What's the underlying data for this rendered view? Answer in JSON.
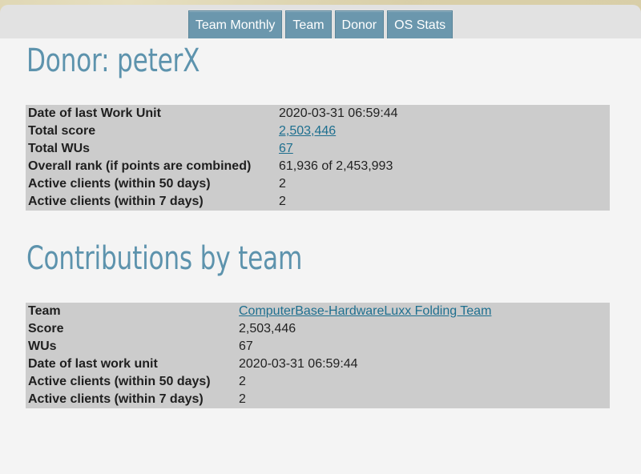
{
  "nav": {
    "tabs": [
      {
        "label": "Team Monthly"
      },
      {
        "label": "Team"
      },
      {
        "label": "Donor"
      },
      {
        "label": "OS Stats"
      }
    ]
  },
  "donor": {
    "heading": "Donor: peterX",
    "rows": [
      {
        "label": "Date of last Work Unit",
        "value": "2020-03-31 06:59:44"
      },
      {
        "label": "Total score",
        "value": "2,503,446"
      },
      {
        "label": "Total WUs",
        "value": "67"
      },
      {
        "label": "Overall rank (if points are combined)",
        "value": "61,936 of 2,453,993"
      },
      {
        "label": "Active clients (within 50 days)",
        "value": "2"
      },
      {
        "label": "Active clients (within 7 days)",
        "value": "2"
      }
    ]
  },
  "contributions": {
    "heading": "Contributions by team",
    "rows": [
      {
        "label": "Team",
        "value": "ComputerBase-HardwareLuxx Folding Team"
      },
      {
        "label": "Score",
        "value": "2,503,446"
      },
      {
        "label": "WUs",
        "value": "67"
      },
      {
        "label": "Date of last work unit",
        "value": "2020-03-31 06:59:44"
      },
      {
        "label": "Active clients (within 50 days)",
        "value": "2"
      },
      {
        "label": "Active clients (within 7 days)",
        "value": "2"
      }
    ]
  },
  "colors": {
    "accent": "#5d93ad",
    "tab": "#6b97ad",
    "link": "#1e6f8f",
    "table_bg": "#cccccc"
  }
}
